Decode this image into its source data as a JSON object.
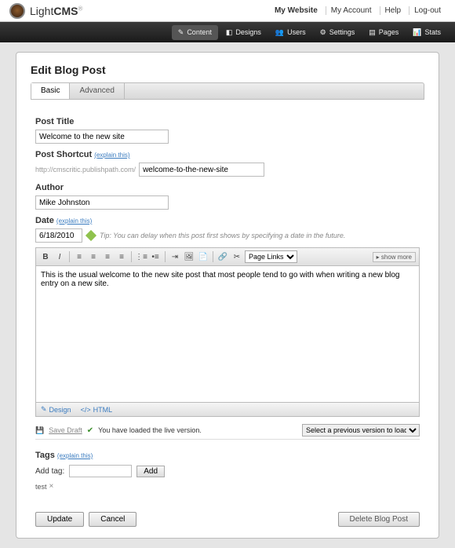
{
  "header": {
    "logo_light": "Light",
    "logo_cms": "CMS",
    "nav": {
      "my_website": "My Website",
      "my_account": "My Account",
      "help": "Help",
      "logout": "Log-out"
    }
  },
  "blackbar": {
    "content": "Content",
    "designs": "Designs",
    "users": "Users",
    "settings": "Settings",
    "pages": "Pages",
    "stats": "Stats"
  },
  "page": {
    "title": "Edit Blog Post",
    "tabs": {
      "basic": "Basic",
      "advanced": "Advanced"
    }
  },
  "form": {
    "post_title_label": "Post Title",
    "post_title_value": "Welcome to the new site",
    "shortcut_label": "Post Shortcut",
    "explain": "(explain this)",
    "shortcut_prefix": "http://cmscritic.publishpath.com/",
    "shortcut_value": "welcome-to-the-new-site",
    "author_label": "Author",
    "author_value": "Mike Johnston",
    "date_label": "Date",
    "date_value": "6/18/2010",
    "date_tip": "Tip: You can delay when this post first shows by specifying a date in the future.",
    "editor": {
      "dropdown": "Page Links",
      "show_more": "show more",
      "content": "This is the usual welcome to the new site post that most people tend to go with when writing a new blog entry on a new site.",
      "design_tab": "Design",
      "html_tab": "HTML"
    },
    "version": {
      "save_draft": "Save Draft",
      "loaded_msg": "You have loaded the live version.",
      "select_placeholder": "Select a previous version to load..."
    },
    "tags": {
      "label": "Tags",
      "add_label": "Add tag:",
      "add_btn": "Add",
      "chip": "test"
    },
    "buttons": {
      "update": "Update",
      "cancel": "Cancel",
      "delete": "Delete Blog Post"
    }
  }
}
